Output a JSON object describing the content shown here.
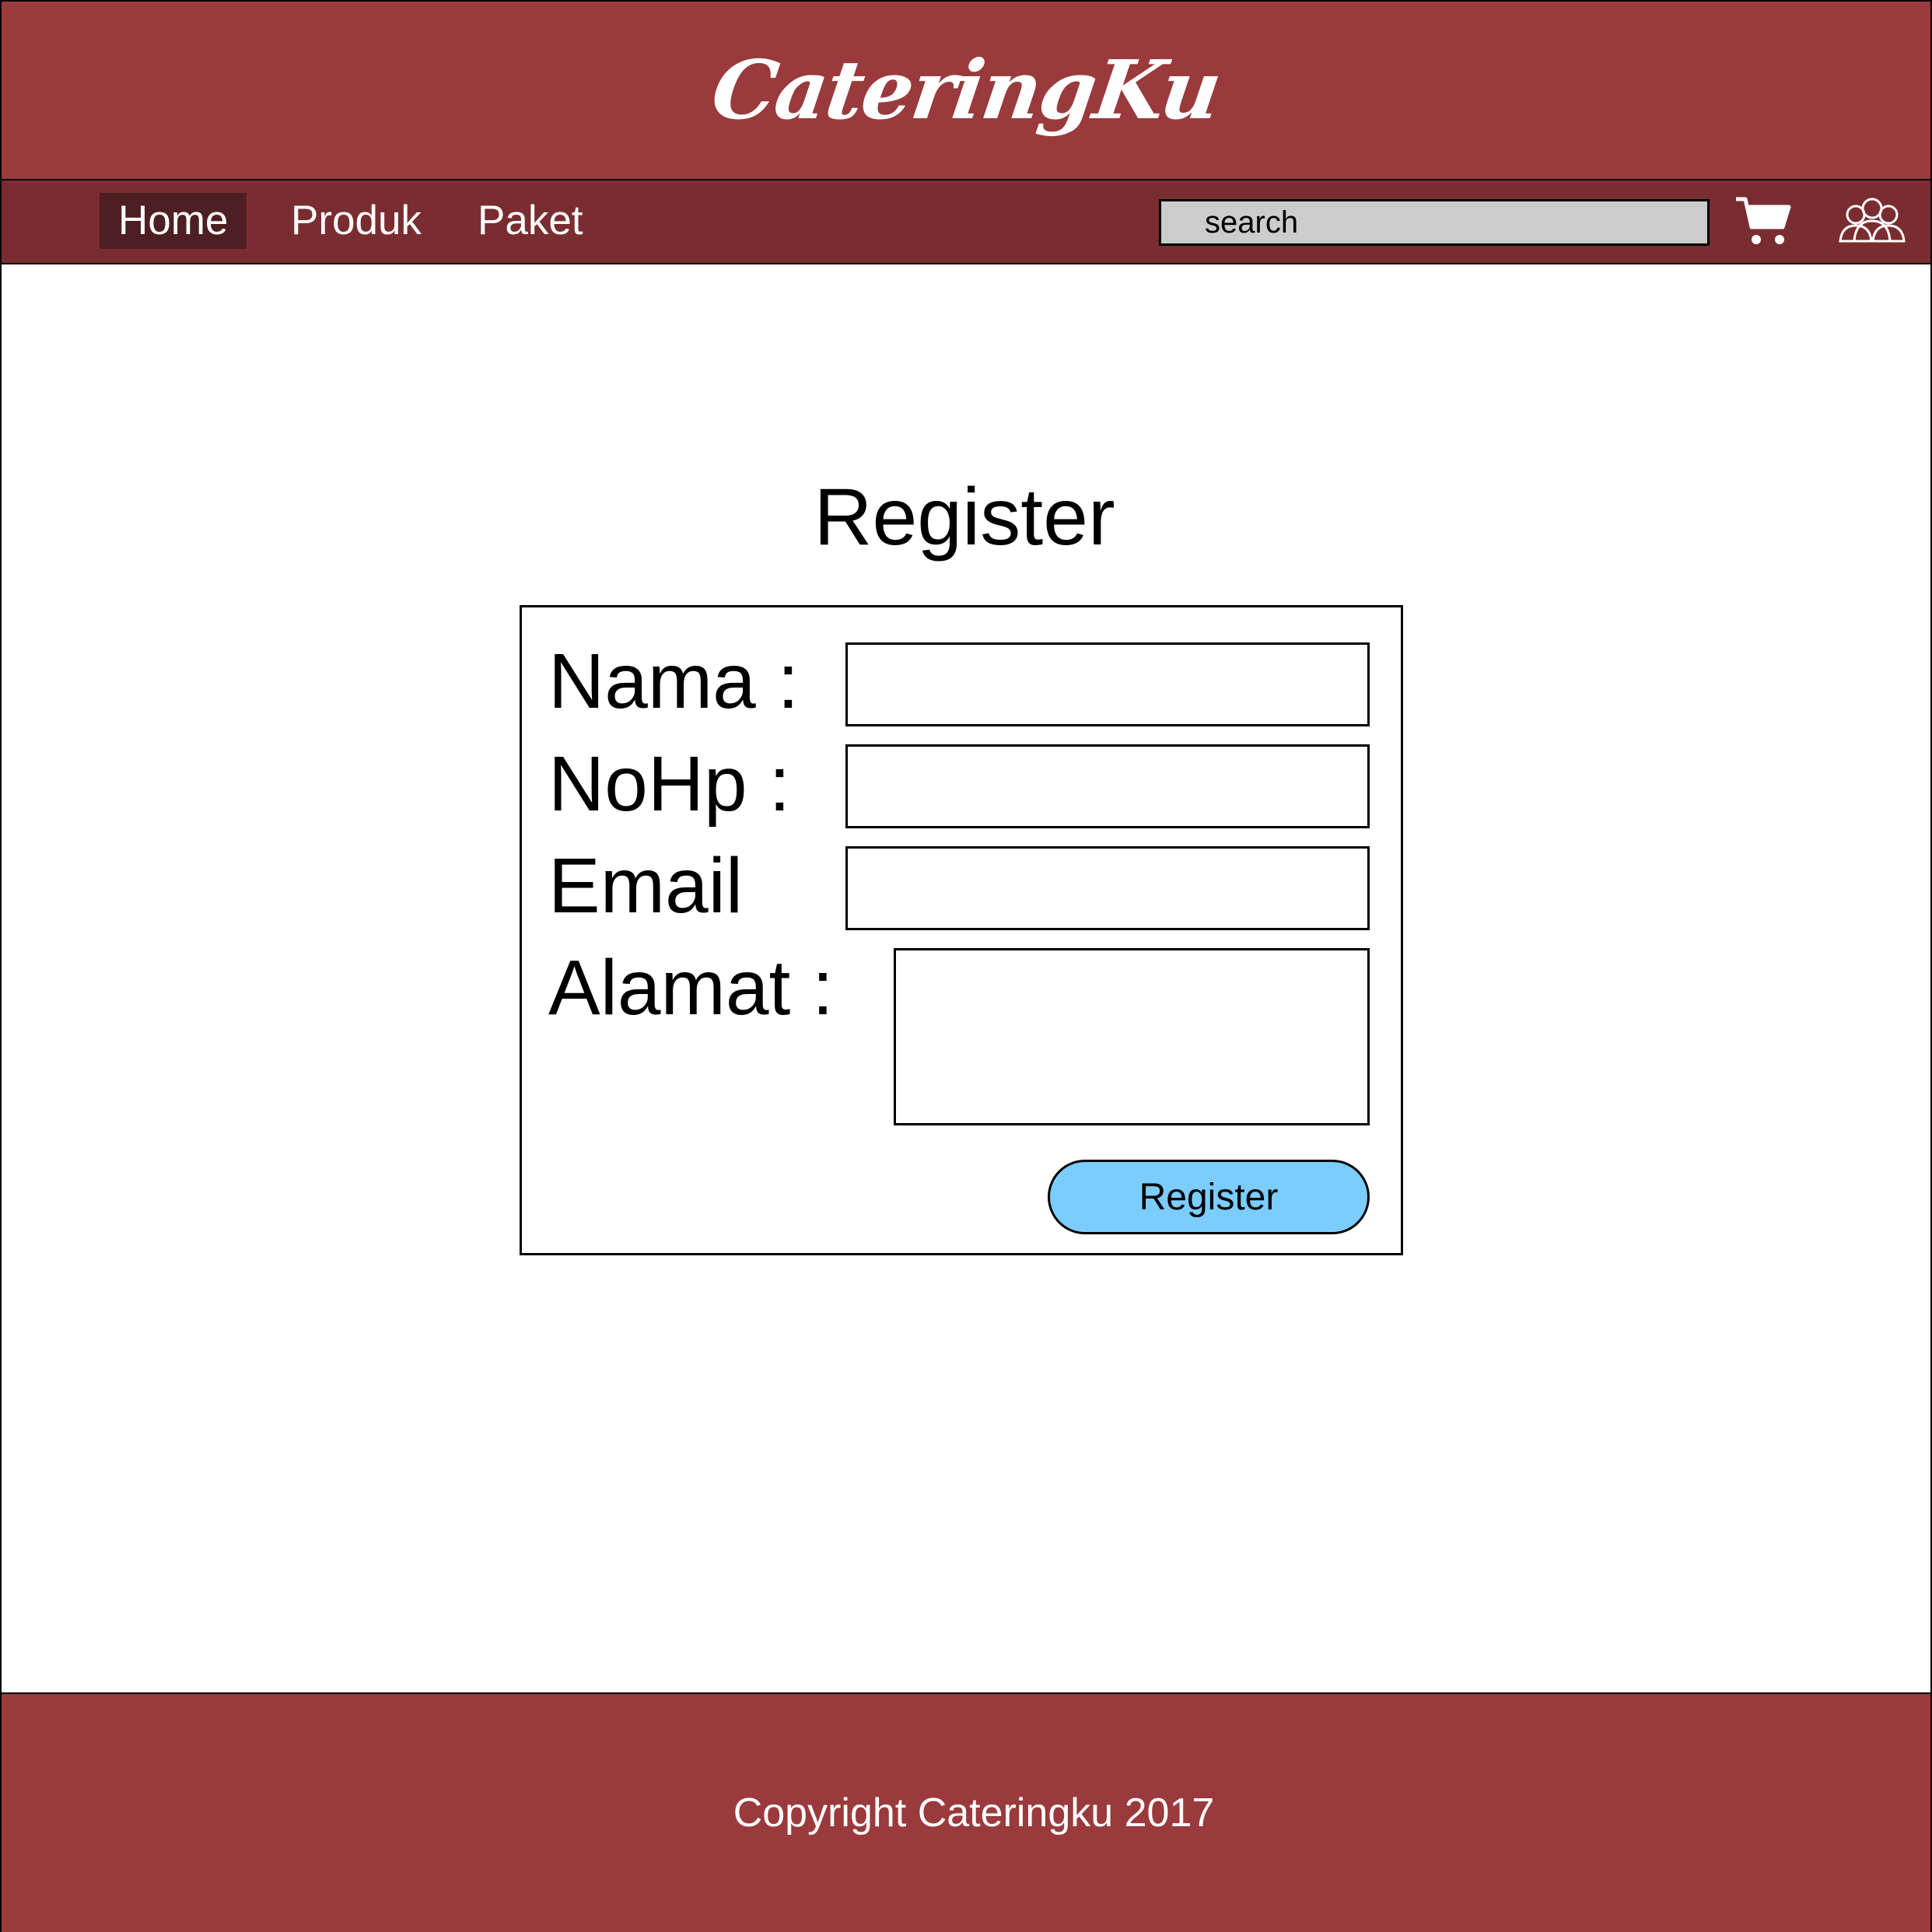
{
  "header": {
    "brand": "CateringKu"
  },
  "nav": {
    "items": [
      {
        "label": "Home",
        "active": true
      },
      {
        "label": "Produk",
        "active": false
      },
      {
        "label": "Paket",
        "active": false
      }
    ],
    "search_placeholder": "search",
    "cart_icon": "cart-icon",
    "user_icon": "users-icon"
  },
  "page": {
    "title": "Register"
  },
  "form": {
    "nama_label": "Nama :",
    "nohp_label": "NoHp :",
    "email_label": "Email",
    "alamat_label": "Alamat :",
    "nama_value": "",
    "nohp_value": "",
    "email_value": "",
    "alamat_value": "",
    "submit_label": "Register"
  },
  "footer": {
    "copyright": "Copyright Cateringku 2017"
  },
  "colors": {
    "header_bg": "#9a3a3c",
    "nav_bg": "#7a2d30",
    "nav_active_bg": "#4e1f22",
    "search_bg": "#cccccc",
    "button_bg": "#7acdfc"
  }
}
